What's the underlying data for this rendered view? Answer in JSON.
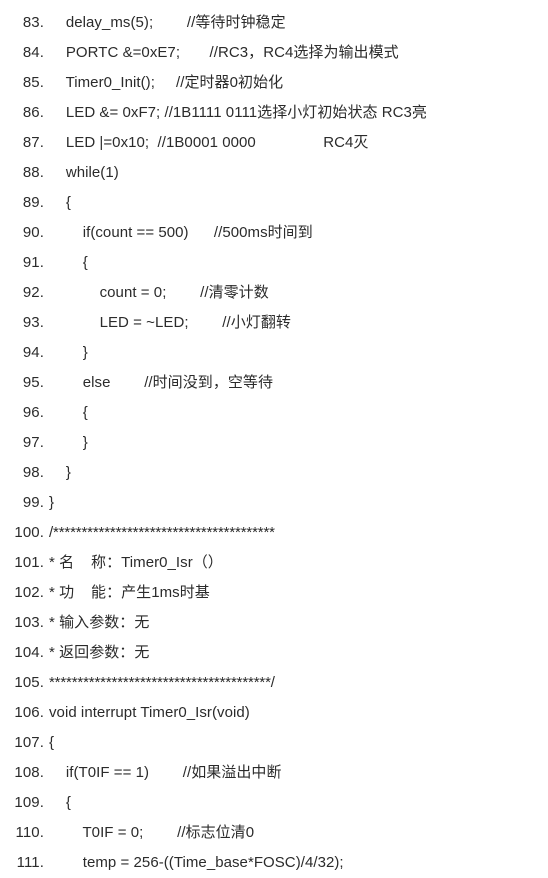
{
  "document": {
    "type": "source-code-listing",
    "language": "C",
    "background_color": "#ffffff",
    "text_color": "#2b2b2b",
    "first_line_number": 83,
    "last_line_number": 111
  },
  "lines": [
    {
      "number": "83.",
      "text": "    delay_ms(5);        //等待时钟稳定"
    },
    {
      "number": "84.",
      "text": "    PORTC &=0xE7;       //RC3，RC4选择为输出模式"
    },
    {
      "number": "85.",
      "text": "    Timer0_Init();     //定时器0初始化"
    },
    {
      "number": "86.",
      "text": "    LED &= 0xF7; //1B1111 0111选择小灯初始状态 RC3亮"
    },
    {
      "number": "87.",
      "text": "    LED |=0x10;  //1B0001 0000                RC4灭"
    },
    {
      "number": "88.",
      "text": "    while(1)"
    },
    {
      "number": "89.",
      "text": "    {"
    },
    {
      "number": "90.",
      "text": "        if(count == 500)      //500ms时间到"
    },
    {
      "number": "91.",
      "text": "        {"
    },
    {
      "number": "92.",
      "text": "            count = 0;        //清零计数"
    },
    {
      "number": "93.",
      "text": "            LED = ~LED;        //小灯翻转"
    },
    {
      "number": "94.",
      "text": "        }"
    },
    {
      "number": "95.",
      "text": "        else        //时间没到，空等待"
    },
    {
      "number": "96.",
      "text": "        {"
    },
    {
      "number": "97.",
      "text": "        }"
    },
    {
      "number": "98.",
      "text": "    }"
    },
    {
      "number": "99.",
      "text": "}"
    },
    {
      "number": "100.",
      "text": "/***************************************"
    },
    {
      "number": "101.",
      "text": "* 名    称：Timer0_Isr（）"
    },
    {
      "number": "102.",
      "text": "* 功    能：产生1ms时基"
    },
    {
      "number": "103.",
      "text": "* 输入参数：无"
    },
    {
      "number": "104.",
      "text": "* 返回参数：无"
    },
    {
      "number": "105.",
      "text": "***************************************/"
    },
    {
      "number": "106.",
      "text": "void interrupt Timer0_Isr(void)"
    },
    {
      "number": "107.",
      "text": "{"
    },
    {
      "number": "108.",
      "text": "    if(T0IF == 1)        //如果溢出中断"
    },
    {
      "number": "109.",
      "text": "    {"
    },
    {
      "number": "110.",
      "text": "        T0IF = 0;        //标志位清0"
    },
    {
      "number": "111.",
      "text": "        temp = 256-((Time_base*FOSC)/4/32);"
    }
  ]
}
